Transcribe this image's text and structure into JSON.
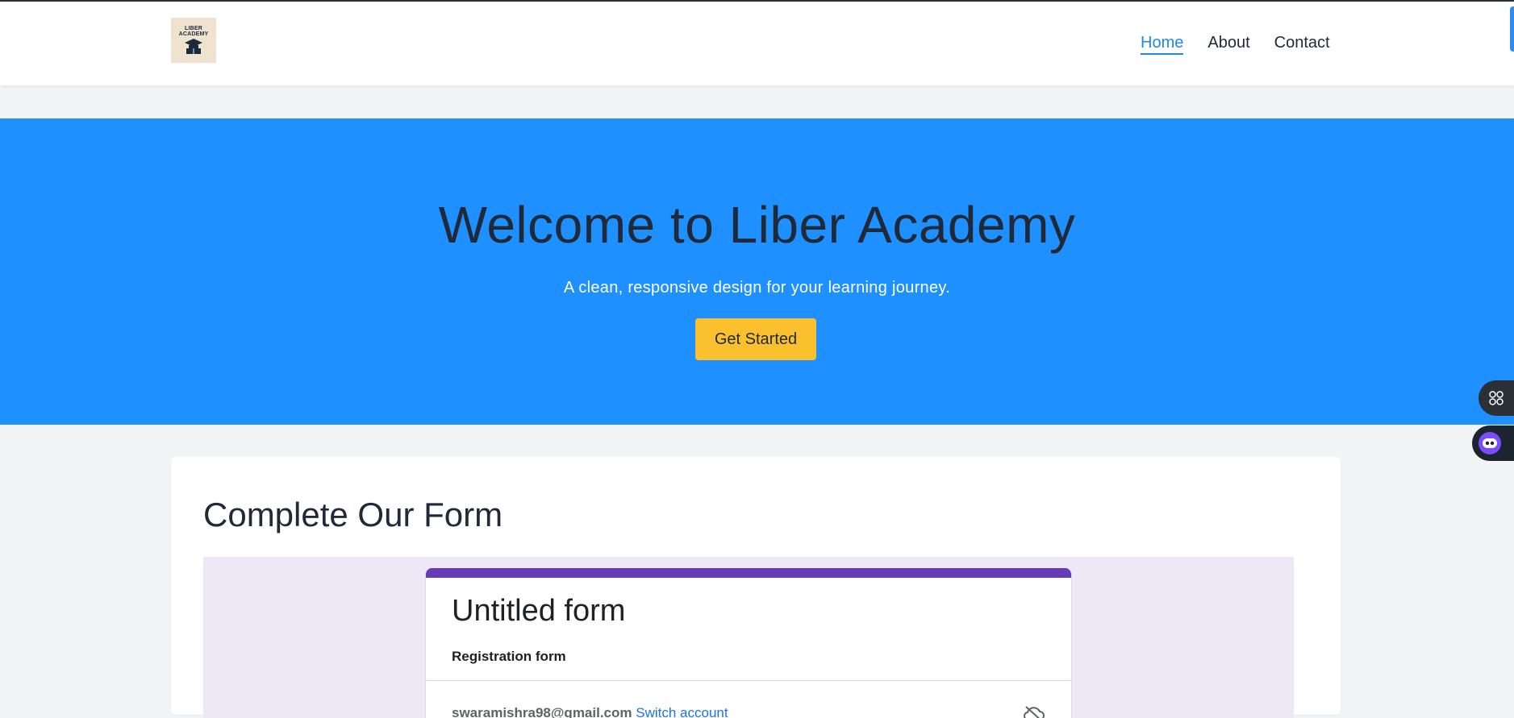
{
  "logo": {
    "line1": "LIBER",
    "line2": "ACADEMY"
  },
  "nav": {
    "home": "Home",
    "about": "About",
    "contact": "Contact"
  },
  "hero": {
    "title": "Welcome to Liber Academy",
    "subtitle": "A clean, responsive design for your learning journey.",
    "cta_label": "Get Started"
  },
  "form_section": {
    "heading": "Complete Our Form",
    "embed": {
      "title": "Untitled form",
      "description": "Registration form",
      "account_email": "swaramishra98@gmail.com",
      "switch_account": "Switch account"
    }
  },
  "colors": {
    "hero_bg": "#1e90ff",
    "nav_active": "#1e88e5",
    "cta_bg": "#fbc02d",
    "form_accent": "#673ab7",
    "form_bg": "#ede7f6"
  },
  "icons": [
    "graduation-cap-book-icon",
    "apps-grid-icon",
    "bot-assistant-icon",
    "cloud-off-icon"
  ]
}
